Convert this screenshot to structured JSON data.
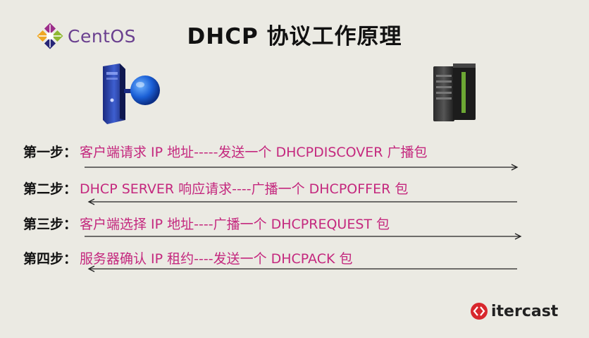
{
  "logo": {
    "text": "CentOS"
  },
  "title": "DHCP 协议工作原理",
  "steps": [
    {
      "label": "第一步：",
      "text": "客户端请求 IP 地址-----发送一个 DHCPDISCOVER 广播包",
      "direction": "right"
    },
    {
      "label": "第二步：",
      "text": "DHCP SERVER 响应请求----广播一个 DHCPOFFER 包",
      "direction": "left"
    },
    {
      "label": "第三步：",
      "text": "客户端选择 IP 地址----广播一个 DHCPREQUEST 包",
      "direction": "right"
    },
    {
      "label": "第四步：",
      "text": "服务器确认 IP 租约----发送一个 DHCPACK 包",
      "direction": "left"
    }
  ],
  "brand": {
    "text": "itercast"
  },
  "colors": {
    "step_text": "#c4287e",
    "logo_text": "#6a3f8f",
    "brand_icon": "#d8272d"
  },
  "icons": {
    "client": "desktop-computer-icon",
    "server": "server-tower-icon"
  }
}
